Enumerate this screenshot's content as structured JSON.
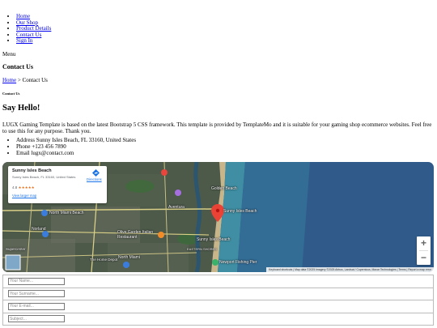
{
  "nav": {
    "items": [
      {
        "label": "Home"
      },
      {
        "label": "Our Shop"
      },
      {
        "label": "Product Details"
      },
      {
        "label": "Contact Us"
      },
      {
        "label": "Sign In"
      }
    ],
    "menu_label": "Menu"
  },
  "page": {
    "title": "Contact Us",
    "breadcrumb": {
      "home": "Home",
      "separator": " > ",
      "current": "Contact Us"
    },
    "small_heading": "Contact Us",
    "hello": "Say Hello!",
    "paragraph": "LUGX Gaming Template is based on the latest Bootstrap 5 CSS framework. This template is provided by TemplateMo and it is suitable for your gaming shop ecommerce websites. Feel free to use this for any purpose. Thank you."
  },
  "contact_info": [
    "Address Sunny Isles Beach, FL 33160, United States",
    "Phone +123 456 7890",
    "Email lugx@contact.com"
  ],
  "map": {
    "place_name": "Sunny Isles Beach",
    "place_address": "Sunny Isles Beach, FL 33160, United States",
    "rating": "4.8",
    "stars": "★★★★★",
    "larger_map": "View larger map",
    "directions": "Directions",
    "labels": {
      "golden_beach": "Golden Beach",
      "marker": "Sunny Isles Beach",
      "aventura": "Aventura",
      "north_miami": "North Miami Beach",
      "norland": "Norland",
      "olive_garden": "Olive Garden Italian Restaurant",
      "sunny_isles": "Sunny Isles Beach",
      "north_miami2": "North Miami",
      "fishing_pier": "Newport Fishing Pier",
      "eastern_shores": "EASTERN SHORES",
      "supercenter": "Supercenter",
      "home_depot": "The Home Depot"
    },
    "zoom_in": "+",
    "zoom_out": "−",
    "attribution": "Keyboard shortcuts | Map data ©2025 Imagery ©2025 Airbus, Landsat / Copernicus, Maxar Technologies | Terms | Report a map error"
  },
  "form": {
    "name_placeholder": "Your Name...",
    "surname_placeholder": "Your Surname...",
    "email_placeholder": "Your E-mail...",
    "subject_placeholder": "Subject..."
  },
  "colors": {
    "link": "#0000ee",
    "ocean": "#2f5a8a",
    "marker": "#ea4335"
  }
}
